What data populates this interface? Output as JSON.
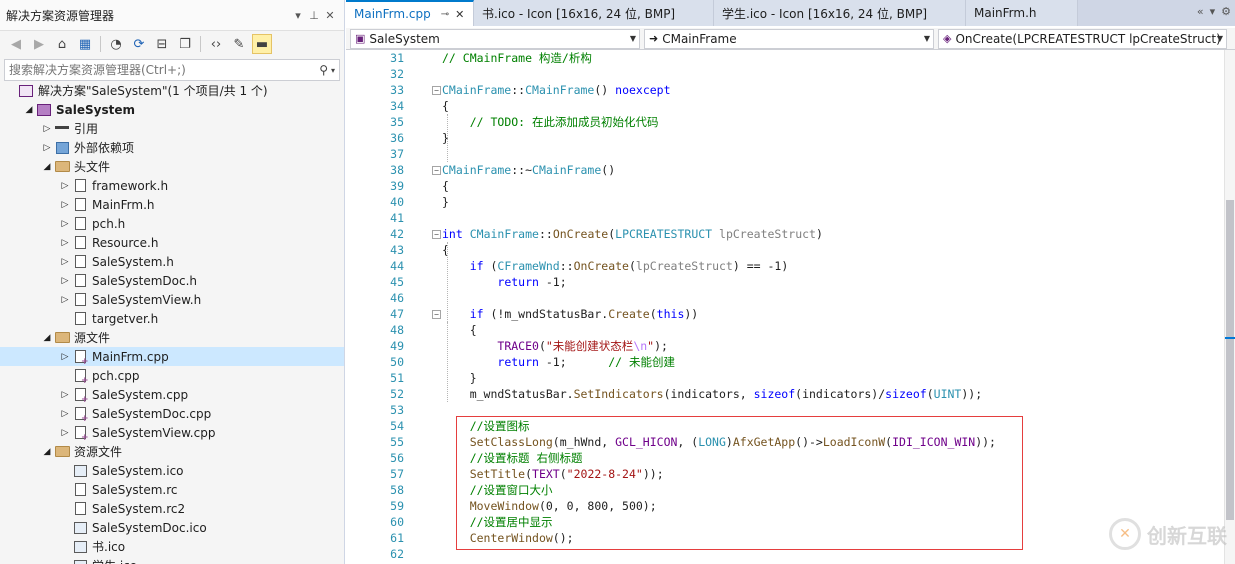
{
  "solution_explorer": {
    "title": "解决方案资源管理器",
    "title_icons": [
      "▾",
      "⊥",
      "✕"
    ],
    "search_placeholder": "搜索解决方案资源管理器(Ctrl+;)",
    "tree": [
      {
        "label": "解决方案\"SaleSystem\"(1 个项目/共 1 个)",
        "indent": 0,
        "expander": "",
        "icon": "sln",
        "bold": false
      },
      {
        "label": "SaleSystem",
        "indent": 1,
        "expander": "◢",
        "icon": "proj",
        "bold": true
      },
      {
        "label": "引用",
        "indent": 2,
        "expander": "▷",
        "icon": "ref",
        "bold": false
      },
      {
        "label": "外部依赖项",
        "indent": 2,
        "expander": "▷",
        "icon": "dep",
        "bold": false
      },
      {
        "label": "头文件",
        "indent": 2,
        "expander": "◢",
        "icon": "folder",
        "bold": false
      },
      {
        "label": "framework.h",
        "indent": 3,
        "expander": "▷",
        "icon": "file",
        "bold": false
      },
      {
        "label": "MainFrm.h",
        "indent": 3,
        "expander": "▷",
        "icon": "file",
        "bold": false
      },
      {
        "label": "pch.h",
        "indent": 3,
        "expander": "▷",
        "icon": "file",
        "bold": false
      },
      {
        "label": "Resource.h",
        "indent": 3,
        "expander": "▷",
        "icon": "file",
        "bold": false
      },
      {
        "label": "SaleSystem.h",
        "indent": 3,
        "expander": "▷",
        "icon": "file",
        "bold": false
      },
      {
        "label": "SaleSystemDoc.h",
        "indent": 3,
        "expander": "▷",
        "icon": "file",
        "bold": false
      },
      {
        "label": "SaleSystemView.h",
        "indent": 3,
        "expander": "▷",
        "icon": "file",
        "bold": false
      },
      {
        "label": "targetver.h",
        "indent": 3,
        "expander": "",
        "icon": "file",
        "bold": false
      },
      {
        "label": "源文件",
        "indent": 2,
        "expander": "◢",
        "icon": "folder",
        "bold": false
      },
      {
        "label": "MainFrm.cpp",
        "indent": 3,
        "expander": "▷",
        "icon": "cpp",
        "bold": false,
        "selected": true
      },
      {
        "label": "pch.cpp",
        "indent": 3,
        "expander": "",
        "icon": "cpp",
        "bold": false
      },
      {
        "label": "SaleSystem.cpp",
        "indent": 3,
        "expander": "▷",
        "icon": "cpp",
        "bold": false
      },
      {
        "label": "SaleSystemDoc.cpp",
        "indent": 3,
        "expander": "▷",
        "icon": "cpp",
        "bold": false
      },
      {
        "label": "SaleSystemView.cpp",
        "indent": 3,
        "expander": "▷",
        "icon": "cpp",
        "bold": false
      },
      {
        "label": "资源文件",
        "indent": 2,
        "expander": "◢",
        "icon": "folder",
        "bold": false
      },
      {
        "label": "SaleSystem.ico",
        "indent": 3,
        "expander": "",
        "icon": "img",
        "bold": false
      },
      {
        "label": "SaleSystem.rc",
        "indent": 3,
        "expander": "",
        "icon": "file",
        "bold": false
      },
      {
        "label": "SaleSystem.rc2",
        "indent": 3,
        "expander": "",
        "icon": "file",
        "bold": false
      },
      {
        "label": "SaleSystemDoc.ico",
        "indent": 3,
        "expander": "",
        "icon": "img",
        "bold": false
      },
      {
        "label": "书.ico",
        "indent": 3,
        "expander": "",
        "icon": "img",
        "bold": false
      },
      {
        "label": "学生.ico",
        "indent": 3,
        "expander": "",
        "icon": "img",
        "bold": false
      }
    ]
  },
  "editor": {
    "tabs": [
      {
        "label": "MainFrm.cpp",
        "active": true,
        "pin": "⊸",
        "close": "✕"
      },
      {
        "label": "书.ico - Icon [16x16, 24 位, BMP]",
        "active": false
      },
      {
        "label": "学生.ico - Icon [16x16, 24 位, BMP]",
        "active": false
      },
      {
        "label": "MainFrm.h",
        "active": false
      }
    ],
    "tab_icons": [
      "«",
      "▾",
      "⚙"
    ],
    "nav": {
      "project": "SaleSystem",
      "scope": "CMainFrame",
      "member": "OnCreate(LPCREATESTRUCT lpCreateStruct)"
    },
    "lines": [
      {
        "n": "31",
        "fold": "",
        "html": "<span class=\"c\">// CMainFrame 构造/析构</span>"
      },
      {
        "n": "32",
        "fold": "",
        "html": ""
      },
      {
        "n": "33",
        "fold": "⊟",
        "html": "<span class=\"t\">CMainFrame</span>::<span class=\"t\">CMainFrame</span>() <span class=\"k\">noexcept</span>"
      },
      {
        "n": "34",
        "fold": "",
        "html": "{"
      },
      {
        "n": "35",
        "fold": "",
        "html": "    <span class=\"c\">// TODO: 在此添加成员初始化代码</span>"
      },
      {
        "n": "36",
        "fold": "",
        "html": "}"
      },
      {
        "n": "37",
        "fold": "",
        "html": ""
      },
      {
        "n": "38",
        "fold": "⊟",
        "html": "<span class=\"t\">CMainFrame</span>::~<span class=\"t\">CMainFrame</span>()"
      },
      {
        "n": "39",
        "fold": "",
        "html": "{"
      },
      {
        "n": "40",
        "fold": "",
        "html": "}"
      },
      {
        "n": "41",
        "fold": "",
        "html": ""
      },
      {
        "n": "42",
        "fold": "⊟",
        "html": "<span class=\"k\">int</span> <span class=\"t\">CMainFrame</span>::<span class=\"f\">OnCreate</span>(<span class=\"t\">LPCREATESTRUCT</span> <span class=\"p\">lpCreateStruct</span>)"
      },
      {
        "n": "43",
        "fold": "",
        "html": "{"
      },
      {
        "n": "44",
        "fold": "",
        "html": "    <span class=\"k\">if</span> (<span class=\"t\">CFrameWnd</span>::<span class=\"f\">OnCreate</span>(<span class=\"p\">lpCreateStruct</span>) == -1)"
      },
      {
        "n": "45",
        "fold": "",
        "html": "        <span class=\"k\">return</span> -1;"
      },
      {
        "n": "46",
        "fold": "",
        "html": ""
      },
      {
        "n": "47",
        "fold": "⊟",
        "html": "    <span class=\"k\">if</span> (!m_wndStatusBar.<span class=\"f\">Create</span>(<span class=\"k\">this</span>))"
      },
      {
        "n": "48",
        "fold": "",
        "html": "    {"
      },
      {
        "n": "49",
        "fold": "",
        "html": "        <span class=\"m\">TRACE0</span>(<span class=\"s\">\"未能创建状态栏<span class=\"esc\">\\n</span>\"</span>);"
      },
      {
        "n": "50",
        "fold": "",
        "html": "        <span class=\"k\">return</span> -1;      <span class=\"c\">// 未能创建</span>"
      },
      {
        "n": "51",
        "fold": "",
        "html": "    }"
      },
      {
        "n": "52",
        "fold": "",
        "html": "    m_wndStatusBar.<span class=\"f\">SetIndicators</span>(indicators, <span class=\"k\">sizeof</span>(indicators)/<span class=\"k\">sizeof</span>(<span class=\"t\">UINT</span>));"
      },
      {
        "n": "53",
        "fold": "",
        "html": ""
      },
      {
        "n": "54",
        "fold": "",
        "html": "    <span class=\"c\">//设置图标</span>"
      },
      {
        "n": "55",
        "fold": "",
        "html": "    <span class=\"f\">SetClassLong</span>(m_hWnd, <span class=\"m\">GCL_HICON</span>, (<span class=\"t\">LONG</span>)<span class=\"f\">AfxGetApp</span>()-><span class=\"f\">LoadIconW</span>(<span class=\"m\">IDI_ICON_WIN</span>));"
      },
      {
        "n": "56",
        "fold": "",
        "html": "    <span class=\"c\">//设置标题 右侧标题</span>"
      },
      {
        "n": "57",
        "fold": "",
        "html": "    <span class=\"f\">SetTitle</span>(<span class=\"m\">TEXT</span>(<span class=\"s\">\"2022-8-24\"</span>));"
      },
      {
        "n": "58",
        "fold": "",
        "html": "    <span class=\"c\">//设置窗口大小</span>"
      },
      {
        "n": "59",
        "fold": "",
        "html": "    <span class=\"f\">MoveWindow</span>(0, 0, 800, 500);"
      },
      {
        "n": "60",
        "fold": "",
        "html": "    <span class=\"c\">//设置居中显示</span>"
      },
      {
        "n": "61",
        "fold": "",
        "html": "    <span class=\"f\">CenterWindow</span>();"
      },
      {
        "n": "62",
        "fold": "",
        "html": ""
      }
    ]
  },
  "watermark": {
    "text": "创新互联",
    "logo": "✕"
  },
  "colors": {
    "accent": "#007acc",
    "highlight_box": "#e53e3e",
    "selection": "#cce8ff",
    "tab_bar": "#cfd6e5"
  }
}
